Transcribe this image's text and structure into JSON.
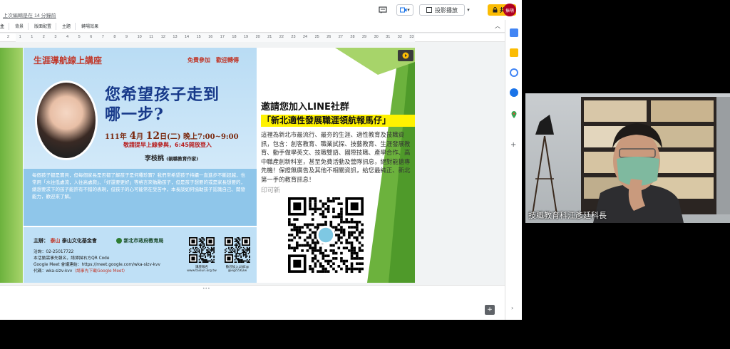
{
  "editor": {
    "last_edit": "上次編輯是在 14 分鐘前",
    "present_label": "投影播放",
    "share_label": "共用",
    "avatar_initials": "振萌",
    "toolbar_items": [
      "背景",
      "版面配置",
      "主題",
      "轉場效果"
    ],
    "ruler_numbers": [
      "2",
      "1",
      "1",
      "2",
      "3",
      "4",
      "5",
      "6",
      "7",
      "8",
      "9",
      "10",
      "11",
      "12",
      "13",
      "14",
      "15",
      "16",
      "17",
      "18",
      "19",
      "20",
      "21",
      "22",
      "23",
      "24",
      "25",
      "26",
      "27",
      "28",
      "29",
      "30",
      "31",
      "32",
      "33"
    ],
    "partial_menu": "主"
  },
  "slide": {
    "poster": {
      "header": "生涯導航線上講座",
      "free": "免費參加　歡迎轉傳",
      "question_line1": "您希望孩子走到",
      "question_line2": "哪一步?",
      "date_prefix": "111年",
      "date_month": "4",
      "date_month_unit": "月",
      "date_day": "12",
      "date_rest": "日(二) 晚上7:00~9:00",
      "login": "敬請提早上線參與，6:45開放登入",
      "speaker": "李枝桃",
      "speaker_title": "(親職教育作家)",
      "body": "每個孩子都是寶貝，但每個家長是否都了解孩子是何種珍寶？我們常希望孩子持續一直進步不斷超越，也常用「水往低處流，人往高處爬」、「好還要更好」等格言來勉勵孩子，但是孩子想要的或是家長想要的，總想要求下的孩子能許有不錯的表現，但孩子的心可能常在受苦中，本長談如何協助孩子認識自己、開發能力，歡迎來了解。",
      "organizer_label": "主辦：",
      "organizer_brand": "泰山",
      "organizer": "泰山文化基金會",
      "co_organizer": "新北市政府教育局",
      "phone": "洽詢：02-25017722",
      "signup": "本活動需事先報名，請掃描右方QR Code",
      "meet_link": "Google Meet 會議連結：https://meet.google.com/wka-sizv-kvv",
      "code_label": "代碼：wka-sizv-kvv",
      "code_note": "（請事先下載Google Meet）",
      "qr1_label": "講座報名",
      "qr2_label": "歡迎加入LINE@",
      "website": "www.taisun.org.tw",
      "line_id": "@egi5562w"
    },
    "invite_title": "邀請您加入LINE社群",
    "group_name": "「新北適性發展職涯領航報馬仔」",
    "info": "這裡為新北市最流行、最夯的生涯、適性教育及技職資訊，包含：創客教育、職業試探、技藝教育、生涯發展教育、動手做學英文、技職雙語、國際技職、產學合作、高中職產創新科室，甚至免費活動及營隊訊息，絕對能搶專先機！保證無廣告及其他不相關資訊，給您最純正、新北第一手的教育訊息！",
    "subtitle": "印可新"
  },
  "webcam": {
    "caption": "技職教育科江彥廷科長"
  },
  "colors": {
    "share_yellow": "#fbbc04",
    "poster_red": "#c0392b",
    "poster_blue": "#183a8a",
    "group_highlight": "#fff200"
  }
}
